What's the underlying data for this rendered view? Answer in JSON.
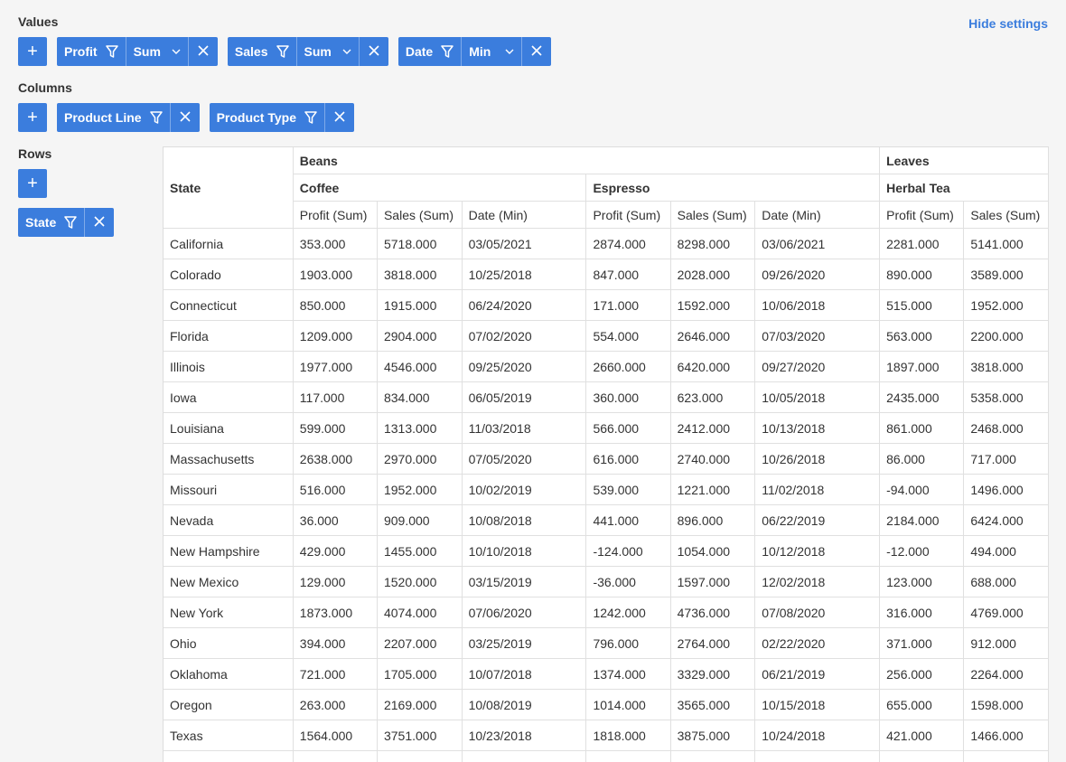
{
  "header": {
    "hide_settings": "Hide settings"
  },
  "values": {
    "label": "Values",
    "add": "+",
    "chips": [
      {
        "name": "Profit",
        "agg": "Sum"
      },
      {
        "name": "Sales",
        "agg": "Sum"
      },
      {
        "name": "Date",
        "agg": "Min"
      }
    ]
  },
  "columns": {
    "label": "Columns",
    "add": "+",
    "chips": [
      {
        "name": "Product Line"
      },
      {
        "name": "Product Type"
      }
    ]
  },
  "rows": {
    "label": "Rows",
    "add": "+",
    "chips": [
      {
        "name": "State"
      }
    ]
  },
  "table": {
    "row_header": "State",
    "groups": [
      {
        "label": "Beans",
        "types": [
          "Coffee",
          "Espresso"
        ]
      },
      {
        "label": "Leaves",
        "types": [
          "Herbal Tea"
        ]
      }
    ],
    "measures": [
      "Profit (Sum)",
      "Sales (Sum)",
      "Date (Min)",
      "Profit (Sum)",
      "Sales (Sum)",
      "Date (Min)",
      "Profit (Sum)",
      "Sales (Sum)"
    ],
    "rows": [
      [
        "California",
        "353.000",
        "5718.000",
        "03/05/2021",
        "2874.000",
        "8298.000",
        "03/06/2021",
        "2281.000",
        "5141.000"
      ],
      [
        "Colorado",
        "1903.000",
        "3818.000",
        "10/25/2018",
        "847.000",
        "2028.000",
        "09/26/2020",
        "890.000",
        "3589.000"
      ],
      [
        "Connecticut",
        "850.000",
        "1915.000",
        "06/24/2020",
        "171.000",
        "1592.000",
        "10/06/2018",
        "515.000",
        "1952.000"
      ],
      [
        "Florida",
        "1209.000",
        "2904.000",
        "07/02/2020",
        "554.000",
        "2646.000",
        "07/03/2020",
        "563.000",
        "2200.000"
      ],
      [
        "Illinois",
        "1977.000",
        "4546.000",
        "09/25/2020",
        "2660.000",
        "6420.000",
        "09/27/2020",
        "1897.000",
        "3818.000"
      ],
      [
        "Iowa",
        "117.000",
        "834.000",
        "06/05/2019",
        "360.000",
        "623.000",
        "10/05/2018",
        "2435.000",
        "5358.000"
      ],
      [
        "Louisiana",
        "599.000",
        "1313.000",
        "11/03/2018",
        "566.000",
        "2412.000",
        "10/13/2018",
        "861.000",
        "2468.000"
      ],
      [
        "Massachusetts",
        "2638.000",
        "2970.000",
        "07/05/2020",
        "616.000",
        "2740.000",
        "10/26/2018",
        "86.000",
        "717.000"
      ],
      [
        "Missouri",
        "516.000",
        "1952.000",
        "10/02/2019",
        "539.000",
        "1221.000",
        "11/02/2018",
        "-94.000",
        "1496.000"
      ],
      [
        "Nevada",
        "36.000",
        "909.000",
        "10/08/2018",
        "441.000",
        "896.000",
        "06/22/2019",
        "2184.000",
        "6424.000"
      ],
      [
        "New Hampshire",
        "429.000",
        "1455.000",
        "10/10/2018",
        "-124.000",
        "1054.000",
        "10/12/2018",
        "-12.000",
        "494.000"
      ],
      [
        "New Mexico",
        "129.000",
        "1520.000",
        "03/15/2019",
        "-36.000",
        "1597.000",
        "12/02/2018",
        "123.000",
        "688.000"
      ],
      [
        "New York",
        "1873.000",
        "4074.000",
        "07/06/2020",
        "1242.000",
        "4736.000",
        "07/08/2020",
        "316.000",
        "4769.000"
      ],
      [
        "Ohio",
        "394.000",
        "2207.000",
        "03/25/2019",
        "796.000",
        "2764.000",
        "02/22/2020",
        "371.000",
        "912.000"
      ],
      [
        "Oklahoma",
        "721.000",
        "1705.000",
        "10/07/2018",
        "1374.000",
        "3329.000",
        "06/21/2019",
        "256.000",
        "2264.000"
      ],
      [
        "Oregon",
        "263.000",
        "2169.000",
        "10/08/2019",
        "1014.000",
        "3565.000",
        "10/15/2018",
        "655.000",
        "1598.000"
      ],
      [
        "Texas",
        "1564.000",
        "3751.000",
        "10/23/2018",
        "1818.000",
        "3875.000",
        "10/24/2018",
        "421.000",
        "1466.000"
      ],
      [
        "",
        "",
        "",
        "",
        "",
        "",
        "",
        "",
        ""
      ]
    ]
  }
}
